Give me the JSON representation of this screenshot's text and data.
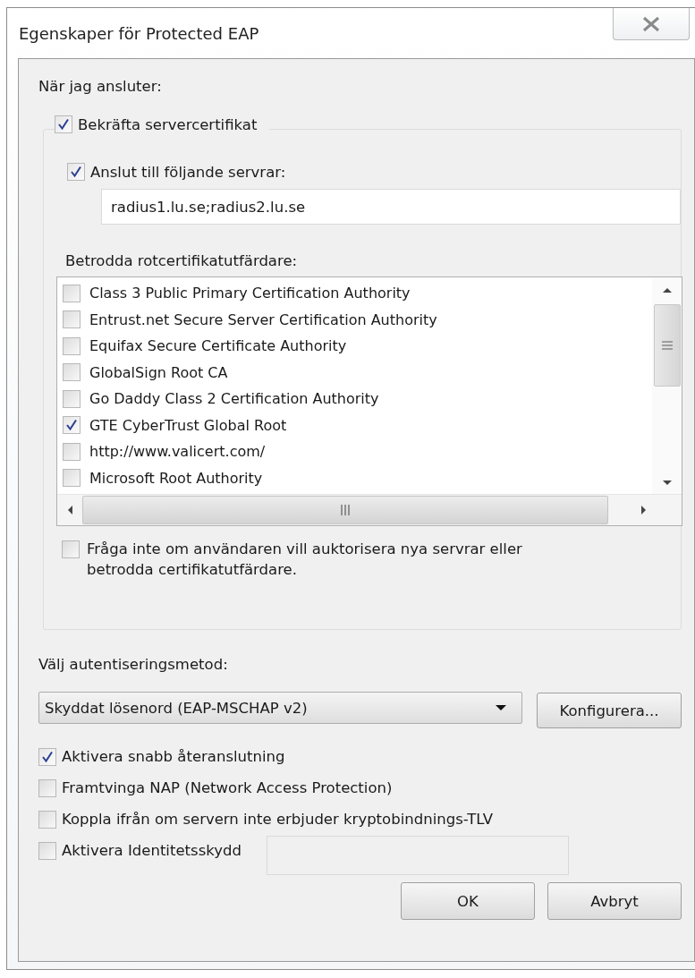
{
  "window": {
    "title": "Egenskaper för Protected EAP"
  },
  "connect_section": {
    "label": "När jag ansluter:",
    "validate_certificate": {
      "label": "Bekräfta servercertifikat",
      "checked": true
    },
    "connect_to_servers": {
      "label": "Anslut till följande servrar:",
      "checked": true
    },
    "servers_field": {
      "value": "radius1.lu.se;radius2.lu.se"
    },
    "trusted_ca": {
      "label": "Betrodda rotcertifikatutfärdare:",
      "items": [
        {
          "label": "Class 3 Public Primary Certification Authority",
          "checked": false
        },
        {
          "label": "Entrust.net Secure Server Certification Authority",
          "checked": false
        },
        {
          "label": "Equifax Secure Certificate Authority",
          "checked": false
        },
        {
          "label": "GlobalSign Root CA",
          "checked": false
        },
        {
          "label": "Go Daddy Class 2 Certification Authority",
          "checked": false
        },
        {
          "label": "GTE CyberTrust Global Root",
          "checked": true
        },
        {
          "label": "http://www.valicert.com/",
          "checked": false
        },
        {
          "label": "Microsoft Root Authority",
          "checked": false
        }
      ]
    },
    "no_prompt": {
      "label": "Fråga inte om användaren vill auktorisera nya servrar eller betrodda certifikatutfärdare.",
      "checked": false
    }
  },
  "auth": {
    "label": "Välj autentiseringsmetod:",
    "method": {
      "value": "Skyddat lösenord (EAP-MSCHAP v2)"
    },
    "configure_button": "Konfigurera...",
    "options": [
      {
        "label": "Aktivera snabb återanslutning",
        "checked": true
      },
      {
        "label": "Framtvinga NAP (Network Access Protection)",
        "checked": false
      },
      {
        "label": "Koppla ifrån om servern inte erbjuder kryptobindnings-TLV",
        "checked": false
      },
      {
        "label": "Aktivera Identitetsskydd",
        "checked": false,
        "kind": "with_field"
      }
    ]
  },
  "buttons": [
    "OK",
    "Avbryt"
  ]
}
